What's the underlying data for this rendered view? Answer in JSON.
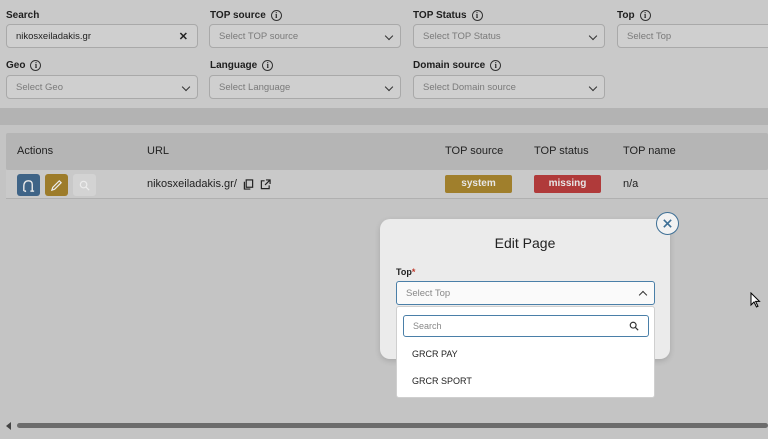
{
  "filters": {
    "search": {
      "label": "Search",
      "value": "nikosxeiladakis.gr"
    },
    "top_source": {
      "label": "TOP source",
      "placeholder": "Select TOP source"
    },
    "top_status": {
      "label": "TOP Status",
      "placeholder": "Select TOP Status"
    },
    "top": {
      "label": "Top",
      "placeholder": "Select Top"
    },
    "geo": {
      "label": "Geo",
      "placeholder": "Select Geo"
    },
    "language": {
      "label": "Language",
      "placeholder": "Select Language"
    },
    "domain_source": {
      "label": "Domain source",
      "placeholder": "Select Domain source"
    }
  },
  "table": {
    "columns": [
      "Actions",
      "URL",
      "TOP source",
      "TOP status",
      "TOP name"
    ],
    "rows": [
      {
        "url": "nikosxeiladakis.gr/",
        "top_source": "system",
        "top_status": "missing",
        "top_name": "n/a"
      }
    ]
  },
  "modal": {
    "title": "Edit Page",
    "field_label": "Top",
    "required_mark": "*",
    "select_placeholder": "Select Top",
    "search_placeholder": "Search",
    "options": [
      "GRCR PAY",
      "GRCR SPORT"
    ]
  },
  "colors": {
    "system_badge": "#a07f2c",
    "missing_badge": "#b03a3a",
    "action_blue": "#3f6487",
    "action_gold": "#9d7c2a",
    "accent": "#4a7fa8"
  }
}
